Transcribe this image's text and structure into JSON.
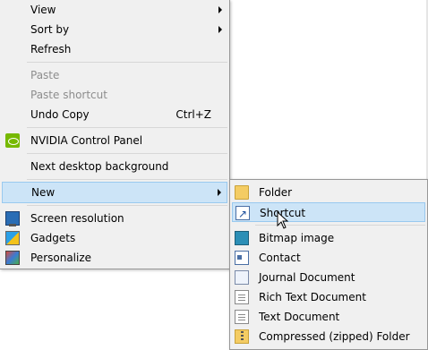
{
  "context_menu": {
    "items": [
      {
        "label": "View",
        "submenu": true
      },
      {
        "label": "Sort by",
        "submenu": true
      },
      {
        "label": "Refresh"
      },
      {
        "label": "Paste",
        "disabled": true
      },
      {
        "label": "Paste shortcut",
        "disabled": true
      },
      {
        "label": "Undo Copy",
        "shortcut": "Ctrl+Z"
      },
      {
        "label": "NVIDIA Control Panel",
        "icon": "nvidia-icon"
      },
      {
        "label": "Next desktop background"
      },
      {
        "label": "New",
        "submenu": true,
        "highlighted": true
      },
      {
        "label": "Screen resolution",
        "icon": "monitor-icon"
      },
      {
        "label": "Gadgets",
        "icon": "gadgets-icon"
      },
      {
        "label": "Personalize",
        "icon": "personalize-icon"
      }
    ]
  },
  "new_submenu": {
    "items": [
      {
        "label": "Folder",
        "icon": "folder-icon"
      },
      {
        "label": "Shortcut",
        "icon": "shortcut-icon",
        "highlighted": true
      },
      {
        "label": "Bitmap image",
        "icon": "bitmap-image-icon"
      },
      {
        "label": "Contact",
        "icon": "contact-icon"
      },
      {
        "label": "Journal Document",
        "icon": "journal-document-icon"
      },
      {
        "label": "Rich Text Document",
        "icon": "rich-text-document-icon"
      },
      {
        "label": "Text Document",
        "icon": "text-document-icon"
      },
      {
        "label": "Compressed (zipped) Folder",
        "icon": "zip-folder-icon"
      }
    ]
  },
  "colors": {
    "menu_bg": "#f0f0f0",
    "highlight_bg": "#cce4f7",
    "highlight_border": "#99c9ef",
    "disabled_text": "#8d8d8d"
  }
}
